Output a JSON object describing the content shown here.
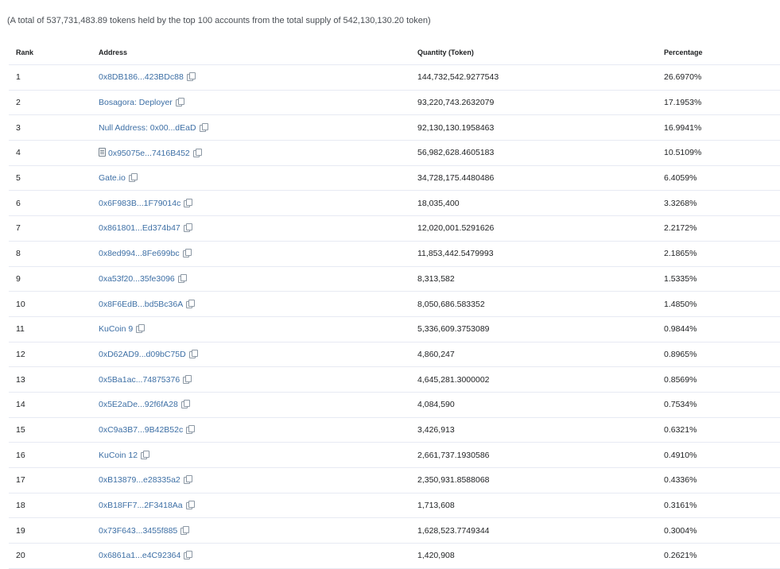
{
  "summary": "(A total of 537,731,483.89 tokens held by the top 100 accounts from the total supply of 542,130,130.20 token)",
  "columns": {
    "rank": "Rank",
    "address": "Address",
    "quantity": "Quantity (Token)",
    "percentage": "Percentage"
  },
  "icons": {
    "copy": "copy-icon",
    "contract": "contract-file-icon"
  },
  "colors": {
    "link": "#3d6fa5",
    "border": "#e7eaf3"
  },
  "rows": [
    {
      "rank": "1",
      "address": "0x8DB186...423BDc88",
      "quantity": "144,732,542.9277543",
      "percentage": "26.6970%",
      "contract": false
    },
    {
      "rank": "2",
      "address": "Bosagora: Deployer",
      "quantity": "93,220,743.2632079",
      "percentage": "17.1953%",
      "contract": false
    },
    {
      "rank": "3",
      "address": "Null Address: 0x00...dEaD",
      "quantity": "92,130,130.1958463",
      "percentage": "16.9941%",
      "contract": false
    },
    {
      "rank": "4",
      "address": "0x95075e...7416B452",
      "quantity": "56,982,628.4605183",
      "percentage": "10.5109%",
      "contract": true
    },
    {
      "rank": "5",
      "address": "Gate.io",
      "quantity": "34,728,175.4480486",
      "percentage": "6.4059%",
      "contract": false
    },
    {
      "rank": "6",
      "address": "0x6F983B...1F79014c",
      "quantity": "18,035,400",
      "percentage": "3.3268%",
      "contract": false
    },
    {
      "rank": "7",
      "address": "0x861801...Ed374b47",
      "quantity": "12,020,001.5291626",
      "percentage": "2.2172%",
      "contract": false
    },
    {
      "rank": "8",
      "address": "0x8ed994...8Fe699bc",
      "quantity": "11,853,442.5479993",
      "percentage": "2.1865%",
      "contract": false
    },
    {
      "rank": "9",
      "address": "0xa53f20...35fe3096",
      "quantity": "8,313,582",
      "percentage": "1.5335%",
      "contract": false
    },
    {
      "rank": "10",
      "address": "0x8F6EdB...bd5Bc36A",
      "quantity": "8,050,686.583352",
      "percentage": "1.4850%",
      "contract": false
    },
    {
      "rank": "11",
      "address": "KuCoin 9",
      "quantity": "5,336,609.3753089",
      "percentage": "0.9844%",
      "contract": false
    },
    {
      "rank": "12",
      "address": "0xD62AD9...d09bC75D",
      "quantity": "4,860,247",
      "percentage": "0.8965%",
      "contract": false
    },
    {
      "rank": "13",
      "address": "0x5Ba1ac...74875376",
      "quantity": "4,645,281.3000002",
      "percentage": "0.8569%",
      "contract": false
    },
    {
      "rank": "14",
      "address": "0x5E2aDe...92f6fA28",
      "quantity": "4,084,590",
      "percentage": "0.7534%",
      "contract": false
    },
    {
      "rank": "15",
      "address": "0xC9a3B7...9B42B52c",
      "quantity": "3,426,913",
      "percentage": "0.6321%",
      "contract": false
    },
    {
      "rank": "16",
      "address": "KuCoin 12",
      "quantity": "2,661,737.1930586",
      "percentage": "0.4910%",
      "contract": false
    },
    {
      "rank": "17",
      "address": "0xB13879...e28335a2",
      "quantity": "2,350,931.8588068",
      "percentage": "0.4336%",
      "contract": false
    },
    {
      "rank": "18",
      "address": "0xB18FF7...2F3418Aa",
      "quantity": "1,713,608",
      "percentage": "0.3161%",
      "contract": false
    },
    {
      "rank": "19",
      "address": "0x73F643...3455f885",
      "quantity": "1,628,523.7749344",
      "percentage": "0.3004%",
      "contract": false
    },
    {
      "rank": "20",
      "address": "0x6861a1...e4C92364",
      "quantity": "1,420,908",
      "percentage": "0.2621%",
      "contract": false
    }
  ]
}
